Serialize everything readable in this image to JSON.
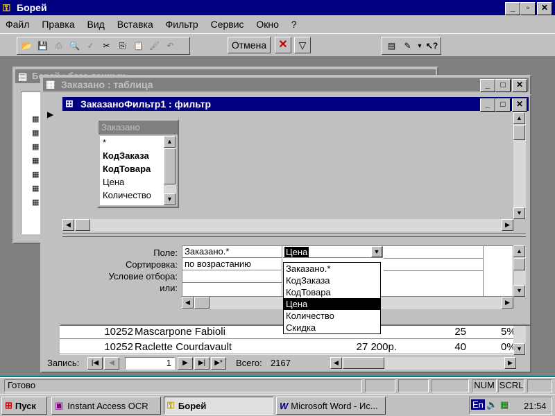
{
  "app": {
    "title": "Борей"
  },
  "menu": [
    "Файл",
    "Правка",
    "Вид",
    "Вставка",
    "Фильтр",
    "Сервис",
    "Окно",
    "?"
  ],
  "toolbar": {
    "cancel_label": "Отмена"
  },
  "bg_window": {
    "title": "Борей : база данных"
  },
  "table_window": {
    "title": "Заказано : таблица"
  },
  "filter_window": {
    "title": "ЗаказаноФильтр1 : фильтр"
  },
  "field_list": {
    "title": "Заказано",
    "items": [
      "*",
      "КодЗаказа",
      "КодТовара",
      "Цена",
      "Количество"
    ]
  },
  "qbe": {
    "row_labels": [
      "Поле:",
      "Сортировка:",
      "Условие отбора:",
      "или:"
    ],
    "col1_field": "Заказано.*",
    "col1_sort": "по возрастанию",
    "col2_field": "Цена",
    "dropdown_options": [
      "Заказано.*",
      "КодЗаказа",
      "КодТовара",
      "Цена",
      "Количество",
      "Скидка"
    ],
    "selected_option": "Цена"
  },
  "data_rows": [
    {
      "order": "10252",
      "product": "Mascarpone Fabioli",
      "price": "",
      "qty": "25",
      "disc": "5%"
    },
    {
      "order": "10252",
      "product": "Raclette Courdavault",
      "price": "27 200р.",
      "qty": "40",
      "disc": "0%"
    }
  ],
  "nav": {
    "record_label": "Запись:",
    "record_value": "1",
    "total_label": "Всего:",
    "total_value": "2167"
  },
  "statusbar": {
    "text": "Готово",
    "num": "NUM",
    "scrl": "SCRL"
  },
  "taskbar": {
    "start": "Пуск",
    "tasks": [
      "Instant Access OCR",
      "Борей",
      "Microsoft Word - Ис..."
    ],
    "lang": "En",
    "time": "21:54"
  }
}
